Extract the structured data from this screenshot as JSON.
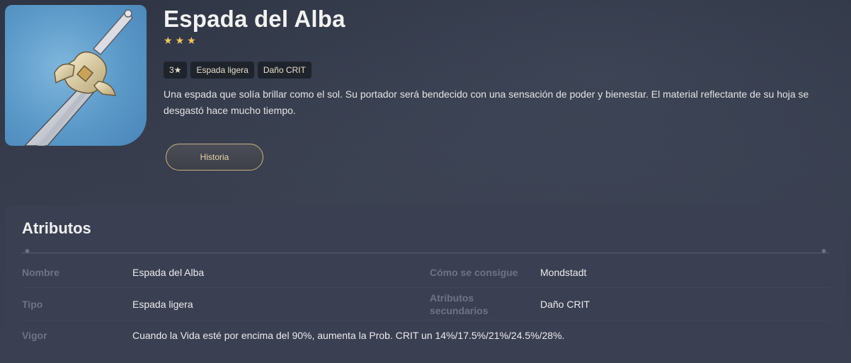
{
  "weapon": {
    "name": "Espada del Alba",
    "rarity_stars": 3,
    "tags": [
      "3★",
      "Espada ligera",
      "Daño CRIT"
    ],
    "description": "Una espada que solía brillar como el sol. Su portador será bendecido con una sensación de poder y bienestar. El material reflectante de su hoja se desgastó hace mucho tiempo.",
    "story_button": "Historia",
    "icon": "sword-icon"
  },
  "attributes": {
    "title": "Atributos",
    "rows": [
      {
        "label": "Nombre",
        "value": "Espada del Alba",
        "label2": "Cómo se consigue",
        "value2": "Mondstadt"
      },
      {
        "label": "Tipo",
        "value": "Espada ligera",
        "label2": "Atributos secundarios",
        "value2": "Daño CRIT"
      },
      {
        "label": "Vigor",
        "value": "Cuando la Vida esté por encima del 90%, aumenta la Prob. CRIT un 14%/17.5%/21%/24.5%/28%."
      }
    ]
  },
  "colors": {
    "star": "#f0c860",
    "accent_border": "#c9b183",
    "thumb_bg": "#5a98c8",
    "panel_bg": "#3a3f52"
  }
}
